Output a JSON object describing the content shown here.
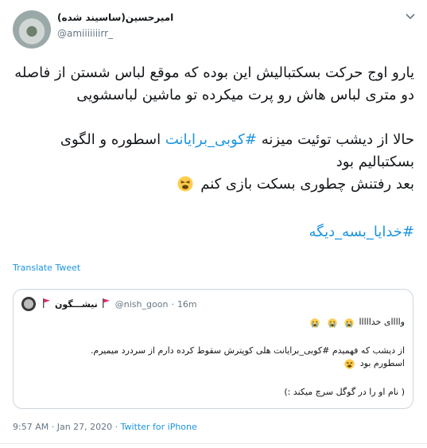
{
  "author": {
    "display_name": "امیرحسین(ساسیند شده)",
    "handle": "@amiiiiiiirr_"
  },
  "tweet": {
    "lines": [
      "یارو اوج حرکت بسکتبالیش این بوده که موقع لباس شستن از فاصله دو متری لباس هاش رو پرت میکرده تو ماشین لباسشویی",
      "حالا از دیشب توئیت میزنه",
      "#کوبی_برایانت",
      "اسطوره و الگوی بسکتبالیم بود",
      "بعد رفتنش چطوری بسکت بازی کنم",
      "#خدایا_بسه_دیگه"
    ]
  },
  "translate_label": "Translate Tweet",
  "quoted": {
    "name": "نیشـــگون",
    "handle": "@nish_goon",
    "separator": "·",
    "time": "16m",
    "line1": "واااای خدااااا",
    "line2": "از دیشب که فهمیدم #کوبی_برایانت هلی کوپترش سقوط کرده دارم از سردرد میمیرم.",
    "line3": "اسطورم بود",
    "line4": "( نام او را در گوگل سرچ میکند :)"
  },
  "footer": {
    "time": "9:57 AM",
    "sep": "·",
    "date": "Jan 27, 2020",
    "sep2": "·",
    "source": "Twitter for iPhone"
  },
  "colors": {
    "link": "#1b95e0",
    "secondary": "#657786",
    "border": "#ccd6dd",
    "flag": "#e0245e"
  },
  "icons": [
    "chevron-down-icon",
    "tired-face-emoji",
    "crying-face-emoji",
    "red-flag-icon"
  ]
}
